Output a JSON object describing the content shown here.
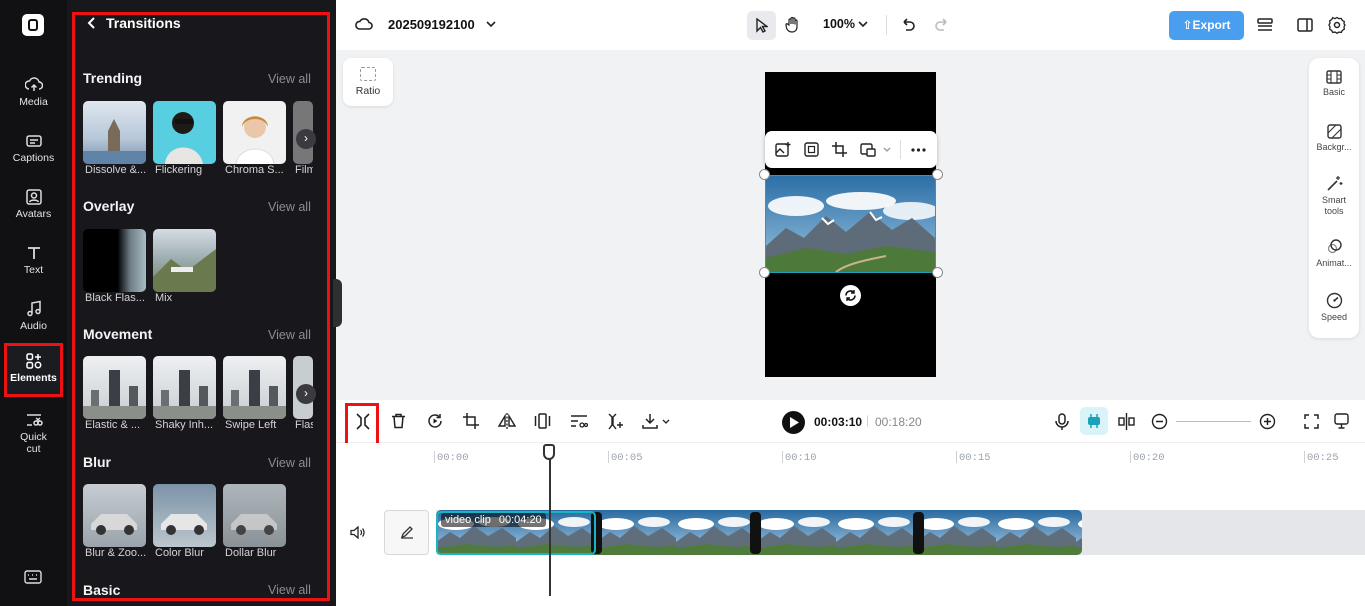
{
  "rail": {
    "items": [
      {
        "label": "Media",
        "icon": "media-upload-icon"
      },
      {
        "label": "Captions",
        "icon": "captions-icon"
      },
      {
        "label": "Avatars",
        "icon": "avatars-icon"
      },
      {
        "label": "Text",
        "icon": "text-icon"
      },
      {
        "label": "Audio",
        "icon": "audio-icon"
      },
      {
        "label": "Elements",
        "icon": "elements-icon",
        "active": true
      },
      {
        "label": "Quick",
        "label2": "cut",
        "icon": "quick-cut-icon"
      }
    ]
  },
  "panel": {
    "title": "Transitions",
    "sections": [
      {
        "title": "Trending",
        "view_all": "View all",
        "items": [
          "Dissolve &...",
          "Flickering",
          "Chroma S...",
          "Film"
        ]
      },
      {
        "title": "Overlay",
        "view_all": "View all",
        "items": [
          "Black Flas...",
          "Mix"
        ]
      },
      {
        "title": "Movement",
        "view_all": "View all",
        "items": [
          "Elastic & ...",
          "Shaky Inh...",
          "Swipe Left",
          "Flas"
        ]
      },
      {
        "title": "Blur",
        "view_all": "View all",
        "items": [
          "Blur & Zoo...",
          "Color Blur",
          "Dollar Blur"
        ]
      },
      {
        "title": "Basic",
        "view_all": "View all",
        "items": []
      }
    ]
  },
  "topbar": {
    "project_name": "202509192100",
    "zoom": "100%",
    "export_label": "Export"
  },
  "canvas": {
    "ratio_label": "Ratio"
  },
  "right_panel": {
    "items": [
      {
        "label": "Basic",
        "icon": "basic-film-icon"
      },
      {
        "label": "Backgr...",
        "icon": "background-icon"
      },
      {
        "label": "Smart",
        "label2": "tools",
        "icon": "magic-wand-icon"
      },
      {
        "label": "Animat...",
        "icon": "animation-icon"
      },
      {
        "label": "Speed",
        "icon": "speed-icon"
      }
    ]
  },
  "timeline": {
    "current_time": "00:03:10",
    "total_time": "00:18:20",
    "ticks": [
      "00:00",
      "00:05",
      "00:10",
      "00:15",
      "00:20",
      "00:25"
    ],
    "clip_label": "video clip",
    "clip_duration": "00:04:20"
  },
  "colors": {
    "accent": "#4a9ef0",
    "selection": "#1ab2c5",
    "highlight": "#e11111"
  }
}
